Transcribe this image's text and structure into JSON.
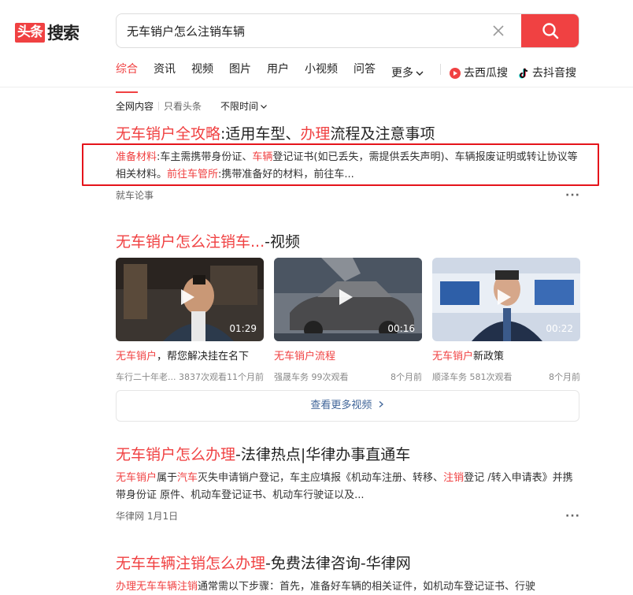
{
  "logo": {
    "box": "头条",
    "text": "搜索"
  },
  "search": {
    "value": "无车销户怎么注销车辆",
    "placeholder": ""
  },
  "nav": {
    "tabs": [
      "综合",
      "资讯",
      "视频",
      "图片",
      "用户",
      "小视频",
      "问答"
    ],
    "more": "更多",
    "ext1": "去西瓜搜",
    "ext2": "去抖音搜"
  },
  "filters": {
    "all": "全网内容",
    "toutiao": "只看头条",
    "time": "不限时间"
  },
  "results": [
    {
      "title_hl": "无车销户全攻略",
      "title_rest": ":适用车型、",
      "title_hl2": "办理",
      "title_rest2": "流程及注意事项",
      "snippet": {
        "p1_hl": "准备材料",
        "p1": ":车主需携带身份证、",
        "p2_hl": "车辆",
        "p2": "登记证书(如已丢失，需提供丢失声明)、车辆报废证明或转让协议等相关材料。",
        "p3_hl": "前往车管所",
        "p3": ":携带准备好的材料，前往车..."
      },
      "source": "就车论事",
      "more": "···"
    },
    {
      "title_hl": "无车销户怎么办理",
      "title_rest": "-法律热点|华律办事直通车",
      "snippet": {
        "a_hl": "无车销户",
        "a": "属于",
        "b_hl": "汽车",
        "b": "灭失申请销户登记，车主应填报《机动车注册、转移、",
        "c_hl": "注销",
        "c": "登记 /转入申请表》并携带身份证 原件、机动车登记证书、机动车行驶证以及..."
      },
      "source": "华律网",
      "date": "1月1日",
      "more": "···"
    },
    {
      "title_hl": "无车车辆注销怎么办理",
      "title_rest": "-免费法律咨询-华律网",
      "snippet": {
        "a_hl": "办理无车车辆注销",
        "a": "通常需以下步骤：首先，准备好车辆的相关证件，如机动车登记证书、行驶"
      }
    }
  ],
  "video_section": {
    "title_hl": "无车销户怎么注销车...",
    "title_rest": "-视频",
    "videos": [
      {
        "duration": "01:29",
        "title_hl": "无车销户",
        "title_rest": "，帮您解决挂在名下",
        "author": "车行二十年老...",
        "views": "3837次观看",
        "time": "11个月前"
      },
      {
        "duration": "00:16",
        "title_hl": "无车销户流程",
        "title_rest": "",
        "author": "强晟车务",
        "views": "99次观看",
        "time": "8个月前"
      },
      {
        "duration": "00:22",
        "title_hl": "无车销户",
        "title_rest": "新政策",
        "author": "顺泽车务",
        "views": "581次观看",
        "time": "8个月前"
      }
    ],
    "more_label": "查看更多视频"
  },
  "colors": {
    "accent": "#f04142",
    "link_blue": "#406599",
    "highlight_box": "#e5141b"
  }
}
